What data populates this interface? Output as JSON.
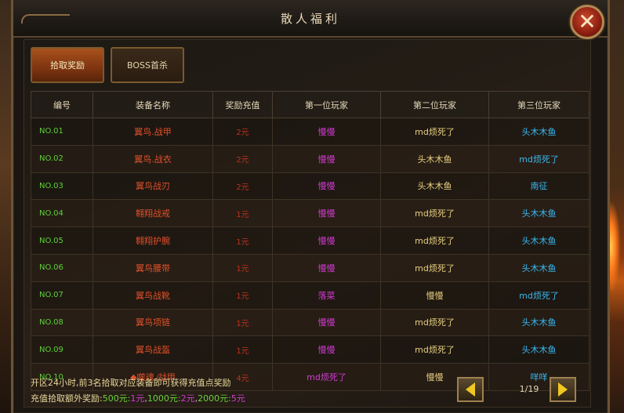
{
  "title": "散人福利",
  "tabs": [
    "拾取奖励",
    "BOSS首杀"
  ],
  "columns": [
    "编号",
    "装备名称",
    "奖励充值",
    "第一位玩家",
    "第二位玩家",
    "第三位玩家"
  ],
  "rows": [
    {
      "no": "NO.01",
      "item": "翼鸟.战甲",
      "prize": "2元",
      "p1": "慢慢",
      "p2": "md烦死了",
      "p3": "头木木鱼"
    },
    {
      "no": "NO.02",
      "item": "翼鸟.战衣",
      "prize": "2元",
      "p1": "慢慢",
      "p2": "头木木鱼",
      "p3": "md烦死了"
    },
    {
      "no": "NO.03",
      "item": "翼鸟战刃",
      "prize": "2元",
      "p1": "慢慢",
      "p2": "头木木鱼",
      "p3": "南征"
    },
    {
      "no": "NO.04",
      "item": "翱翔战戒",
      "prize": "1元",
      "p1": "慢慢",
      "p2": "md烦死了",
      "p3": "头木木鱼"
    },
    {
      "no": "NO.05",
      "item": "翱翔护腕",
      "prize": "1元",
      "p1": "慢慢",
      "p2": "md烦死了",
      "p3": "头木木鱼"
    },
    {
      "no": "NO.06",
      "item": "翼鸟腰带",
      "prize": "1元",
      "p1": "慢慢",
      "p2": "md烦死了",
      "p3": "头木木鱼"
    },
    {
      "no": "NO.07",
      "item": "翼鸟战靴",
      "prize": "1元",
      "p1": "落菜",
      "p2": "慢慢",
      "p3": "md烦死了"
    },
    {
      "no": "NO.08",
      "item": "翼鸟项链",
      "prize": "1元",
      "p1": "慢慢",
      "p2": "md烦死了",
      "p3": "头木木鱼"
    },
    {
      "no": "NO.09",
      "item": "翼鸟战盔",
      "prize": "1元",
      "p1": "慢慢",
      "p2": "md烦死了",
      "p3": "头木木鱼"
    },
    {
      "no": "NO.10",
      "item": "◆噬魂.⁄战甲",
      "prize": "4元",
      "p1": "md烦死了",
      "p2": "慢慢",
      "p3": "咩咩"
    }
  ],
  "notes": {
    "line1": "开区24小时,前3名拾取对应装备即可获得充值点奖励",
    "line2_prefix": "充值拾取额外奖励:",
    "r1": "500元:",
    "r1v": "1元",
    "r2": "1000元:",
    "r2v": "2元",
    "r3": "2000元:",
    "r3v": "5元"
  },
  "pager": {
    "page": "1/19"
  }
}
